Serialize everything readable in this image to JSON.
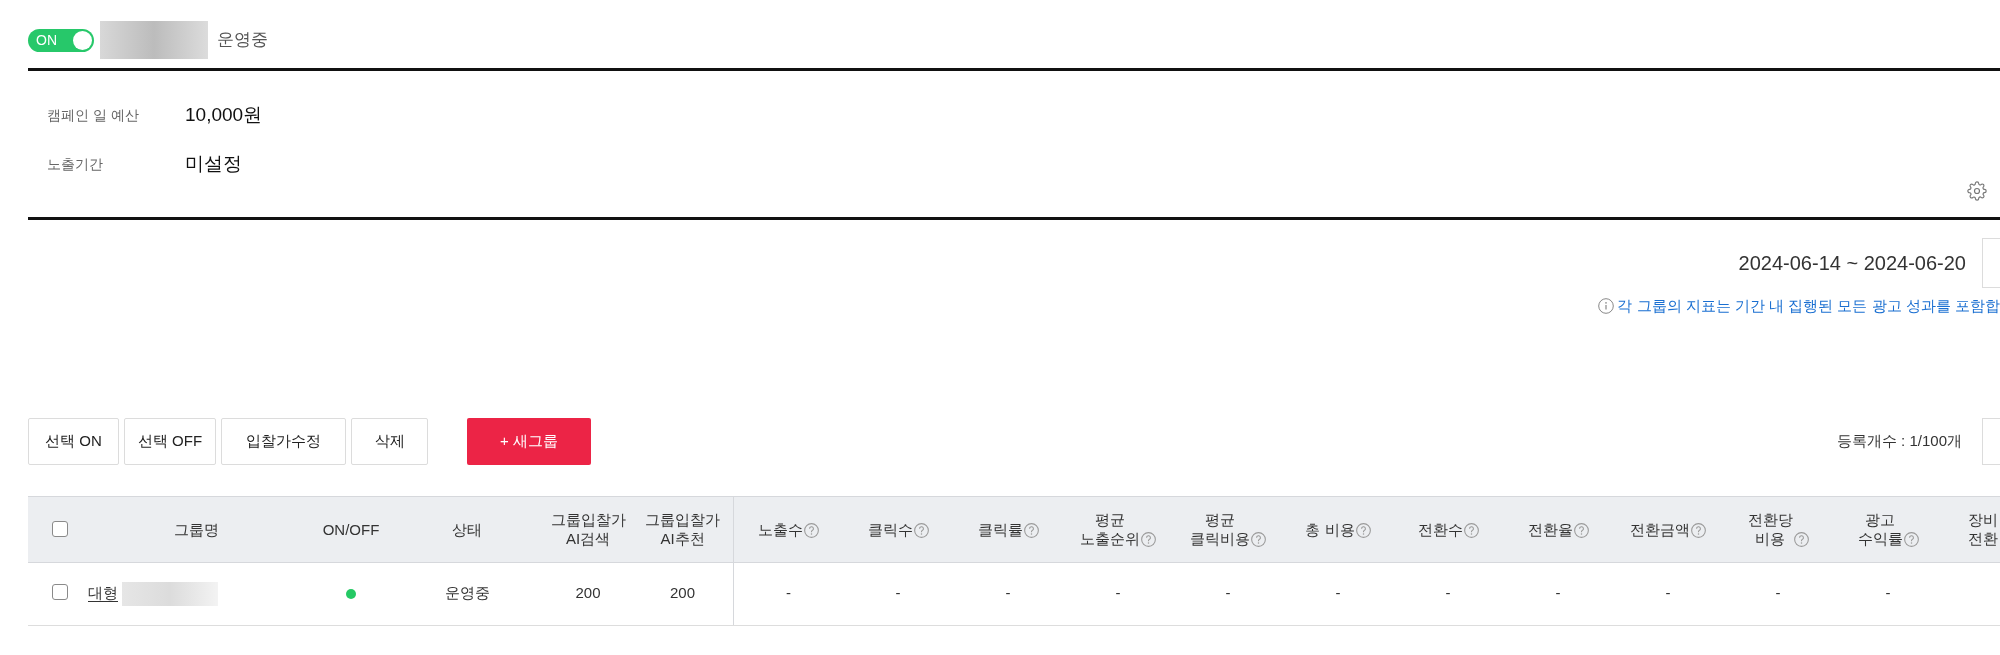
{
  "campaign": {
    "toggle": {
      "label": "ON",
      "on": true
    },
    "status": "운영중"
  },
  "details": [
    {
      "label": "캠페인 일 예산",
      "value": "10,000원"
    },
    {
      "label": "노출기간",
      "value": "미설정"
    }
  ],
  "period": {
    "date_range": "2024-06-14 ~ 2024-06-20",
    "notice": "각 그룹의 지표는 기간 내 집행된 모든 광고 성과를 포함합"
  },
  "toolbar": {
    "buttons": [
      {
        "label": "선택 ON",
        "kind": "plain"
      },
      {
        "label": "선택 OFF",
        "kind": "plain"
      },
      {
        "label": "입찰가수정",
        "kind": "plain"
      },
      {
        "label": "삭제",
        "kind": "plain"
      },
      {
        "label": "+ 새그룹",
        "kind": "primary"
      }
    ],
    "count": "등록개수 : 1/100개"
  },
  "table": {
    "select_all": {
      "checked": false
    },
    "columns": [
      {
        "lines": [
          "그룹명"
        ],
        "help": false
      },
      {
        "lines": [
          "ON/OFF"
        ],
        "help": false
      },
      {
        "lines": [
          "상태"
        ],
        "help": false
      },
      {
        "lines": [
          "그룹입찰가",
          "AI검색"
        ],
        "help": false
      },
      {
        "lines": [
          "그룹입찰가",
          "AI추천"
        ],
        "help": false
      },
      {
        "lines": [
          "노출수"
        ],
        "help": true
      },
      {
        "lines": [
          "클릭수"
        ],
        "help": true
      },
      {
        "lines": [
          "클릭률"
        ],
        "help": true
      },
      {
        "lines": [
          "평균",
          "노출순위"
        ],
        "help": true
      },
      {
        "lines": [
          "평균",
          "클릭비용"
        ],
        "help": true
      },
      {
        "lines": [
          "총 비용"
        ],
        "help": true
      },
      {
        "lines": [
          "전환수"
        ],
        "help": true
      },
      {
        "lines": [
          "전환율"
        ],
        "help": true
      },
      {
        "lines": [
          "전환금액"
        ],
        "help": true
      },
      {
        "lines": [
          "전환당",
          "비용"
        ],
        "help": true
      },
      {
        "lines": [
          "광고",
          "수익률"
        ],
        "help": true
      },
      {
        "lines": [
          "장비",
          "전환"
        ],
        "help": false
      }
    ],
    "rows": [
      {
        "checked": false,
        "cells": [
          {
            "kind": "link",
            "text": "대형"
          },
          {
            "kind": "indicator",
            "on": true
          },
          {
            "kind": "text",
            "text": "운영중"
          },
          {
            "kind": "text",
            "text": "200"
          },
          {
            "kind": "text",
            "text": "200"
          },
          {
            "kind": "text",
            "text": "-"
          },
          {
            "kind": "text",
            "text": "-"
          },
          {
            "kind": "text",
            "text": "-"
          },
          {
            "kind": "text",
            "text": "-"
          },
          {
            "kind": "text",
            "text": "-"
          },
          {
            "kind": "text",
            "text": "-"
          },
          {
            "kind": "text",
            "text": "-"
          },
          {
            "kind": "text",
            "text": "-"
          },
          {
            "kind": "text",
            "text": "-"
          },
          {
            "kind": "text",
            "text": "-"
          },
          {
            "kind": "text",
            "text": "-"
          }
        ]
      }
    ]
  }
}
